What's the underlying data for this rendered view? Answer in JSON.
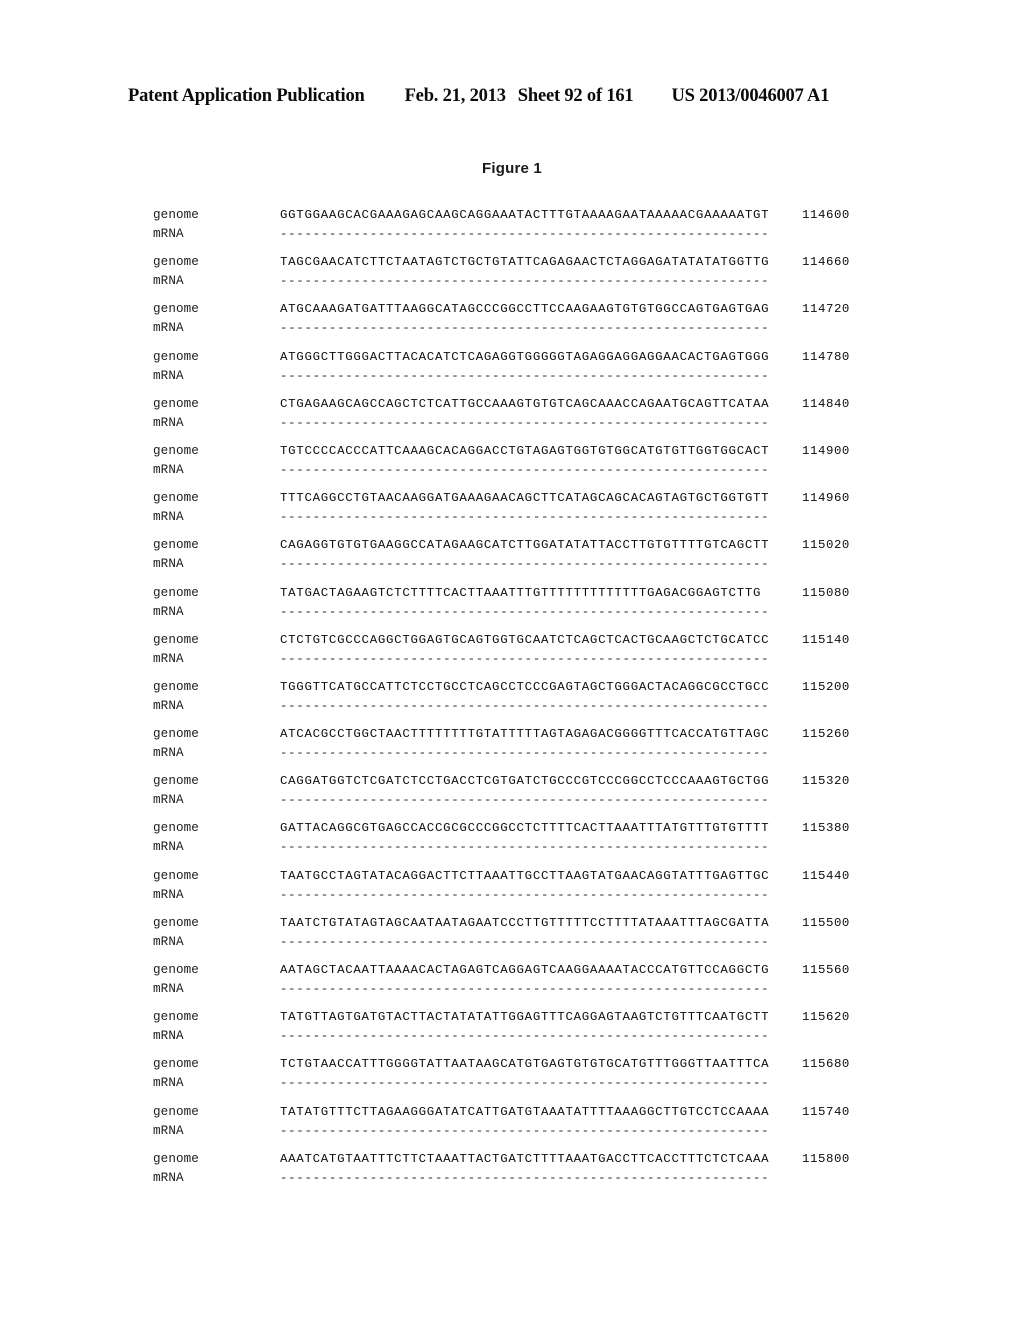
{
  "header": {
    "publication_label": "Patent Application Publication",
    "date": "Feb. 21, 2013",
    "sheet": "Sheet 92 of 161",
    "publication_number": "US 2013/0046007 A1"
  },
  "figure": {
    "caption": "Figure 1"
  },
  "alignment": {
    "labels": {
      "genome": "genome",
      "mrna": "mRNA"
    },
    "gap_line": "------------------------------------------------------------",
    "blocks": [
      {
        "genome": "GGTGGAAGCACGAAAGAGCAAGCAGGAAATACTTTGTAAAAGAATAAAAACGAAAAATGT",
        "mrna": "------------------------------------------------------------",
        "position": "114600"
      },
      {
        "genome": "TAGCGAACATCTTCTAATAGTCTGCTGTATTCAGAGAACTCTAGGAGATATATATGGTTG",
        "mrna": "------------------------------------------------------------",
        "position": "114660"
      },
      {
        "genome": "ATGCAAAGATGATTTAAGGCATAGCCCGGCCTTCCAAGAAGTGTGTGGCCAGTGAGTGAG",
        "mrna": "------------------------------------------------------------",
        "position": "114720"
      },
      {
        "genome": "ATGGGCTTGGGACTTACACATCTCAGAGGTGGGGGTAGAGGAGGAGGAACACTGAGTGGG",
        "mrna": "------------------------------------------------------------",
        "position": "114780"
      },
      {
        "genome": "CTGAGAAGCAGCCAGCTCTCATTGCCAAAGTGTGTCAGCAAACCAGAATGCAGTTCATAA",
        "mrna": "------------------------------------------------------------",
        "position": "114840"
      },
      {
        "genome": "TGTCCCCACCCATTCAAAGCACAGGACCTGTAGAGTGGTGTGGCATGTGTTGGTGGCACT",
        "mrna": "------------------------------------------------------------",
        "position": "114900"
      },
      {
        "genome": "TTTCAGGCCTGTAACAAGGATGAAAGAACAGCTTCATAGCAGCACAGTAGTGCTGGTGTT",
        "mrna": "------------------------------------------------------------",
        "position": "114960"
      },
      {
        "genome": "CAGAGGTGTGTGAAGGCCATAGAAGCATCTTGGATATATTACCTTGTGTTTTGTCAGCTT",
        "mrna": "------------------------------------------------------------",
        "position": "115020"
      },
      {
        "genome": "TATGACTAGAAGTCTCTTTTCACTTAAATTTGTTTTTTTTTTTTTGAGACGGAGTCTTG",
        "mrna": "------------------------------------------------------------",
        "position": "115080"
      },
      {
        "genome": "CTCTGTCGCCCAGGCTGGAGTGCAGTGGTGCAATCTCAGCTCACTGCAAGCTCTGCATCC",
        "mrna": "------------------------------------------------------------",
        "position": "115140"
      },
      {
        "genome": "TGGGTTCATGCCATTCTCCTGCCTCAGCCTCCCGAGTAGCTGGGACTACAGGCGCCTGCC",
        "mrna": "------------------------------------------------------------",
        "position": "115200"
      },
      {
        "genome": "ATCACGCCTGGCTAACTTTTTTTTGTATTTTTAGTAGAGACGGGGTTTCACCATGTTAGC",
        "mrna": "------------------------------------------------------------",
        "position": "115260"
      },
      {
        "genome": "CAGGATGGTCTCGATCTCCTGACCTCGTGATCTGCCCGTCCCGGCCTCCCAAAGTGCTGG",
        "mrna": "------------------------------------------------------------",
        "position": "115320"
      },
      {
        "genome": "GATTACAGGCGTGAGCCACCGCGCCCGGCCTCTTTTCACTTAAATTTATGTTTGTGTTTT",
        "mrna": "------------------------------------------------------------",
        "position": "115380"
      },
      {
        "genome": "TAATGCCTAGTATACAGGACTTCTTAAATTGCCTTAAGTATGAACAGGTATTTGAGTTGC",
        "mrna": "------------------------------------------------------------",
        "position": "115440"
      },
      {
        "genome": "TAATCTGTATAGTAGCAATAATAGAATCCCTTGTTTTTCCTTTTATAAATTTAGCGATTA",
        "mrna": "------------------------------------------------------------",
        "position": "115500"
      },
      {
        "genome": "AATAGCTACAATTAAAACACTAGAGTCAGGAGTCAAGGAAAATACCCATGTTCCAGGCTG",
        "mrna": "------------------------------------------------------------",
        "position": "115560"
      },
      {
        "genome": "TATGTTAGTGATGTACTTACTATATATTGGAGTTTCAGGAGTAAGTCTGTTTCAATGCTT",
        "mrna": "------------------------------------------------------------",
        "position": "115620"
      },
      {
        "genome": "TCTGTAACCATTTGGGGTATTAATAAGCATGTGAGTGTGTGCATGTTTGGGTTAATTTCA",
        "mrna": "------------------------------------------------------------",
        "position": "115680"
      },
      {
        "genome": "TATATGTTTCTTAGAAGGGATATCATTGATGTAAATATTTTAAAGGCTTGTCCTCCAAAA",
        "mrna": "------------------------------------------------------------",
        "position": "115740"
      },
      {
        "genome": "AAATCATGTAATTTCTTCTAAATTACTGATCTTTTAAATGACCTTCACCTTTCTCTCAAA",
        "mrna": "------------------------------------------------------------",
        "position": "115800"
      }
    ]
  }
}
